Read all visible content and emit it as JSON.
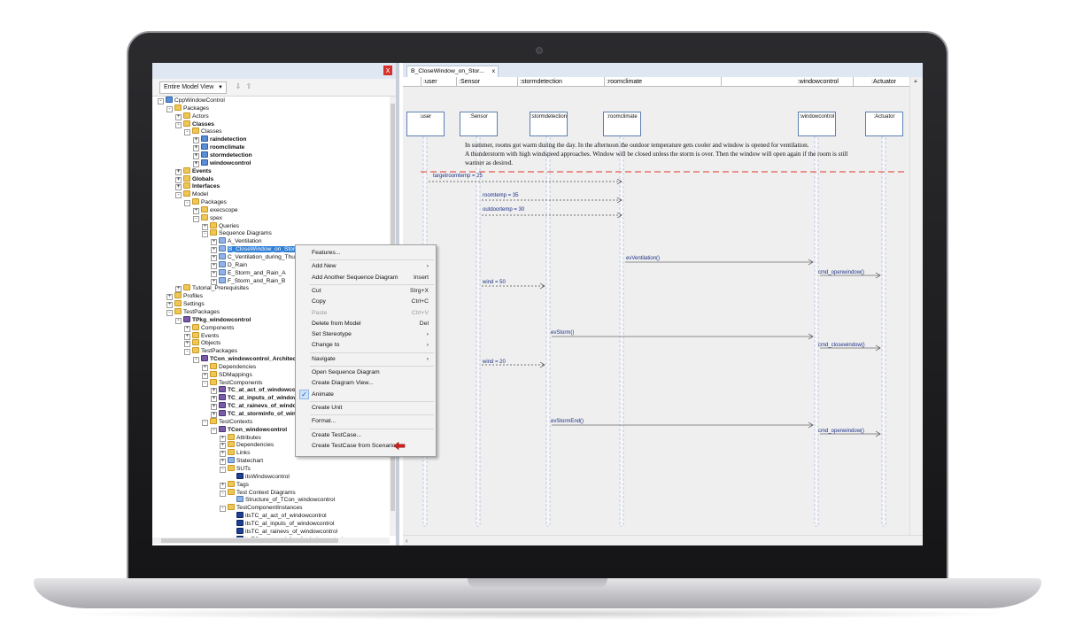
{
  "tree": {
    "view_select": "Entire Model View",
    "close_label": "x",
    "items": [
      {
        "label": "CppWindowControl",
        "depth": 0,
        "icon": "project",
        "exp": "-"
      },
      {
        "label": "Packages",
        "depth": 1,
        "icon": "folder",
        "exp": "-"
      },
      {
        "label": "Actors",
        "depth": 2,
        "icon": "folder",
        "exp": "+"
      },
      {
        "label": "Classes",
        "depth": 2,
        "icon": "folder",
        "exp": "-",
        "bold": true
      },
      {
        "label": "Classes",
        "depth": 3,
        "icon": "folder",
        "exp": "-"
      },
      {
        "label": "raindetection",
        "depth": 4,
        "icon": "class",
        "exp": "+",
        "bold": true
      },
      {
        "label": "roomclimate",
        "depth": 4,
        "icon": "class",
        "exp": "+",
        "bold": true
      },
      {
        "label": "stormdetection",
        "depth": 4,
        "icon": "class",
        "exp": "+",
        "bold": true
      },
      {
        "label": "windowcontrol",
        "depth": 4,
        "icon": "class",
        "exp": "+",
        "bold": true
      },
      {
        "label": "Events",
        "depth": 2,
        "icon": "folder",
        "exp": "+",
        "bold": true
      },
      {
        "label": "Globals",
        "depth": 2,
        "icon": "folder",
        "exp": "+",
        "bold": true
      },
      {
        "label": "Interfaces",
        "depth": 2,
        "icon": "folder",
        "exp": "+",
        "bold": true
      },
      {
        "label": "Model",
        "depth": 2,
        "icon": "folder",
        "exp": "-"
      },
      {
        "label": "Packages",
        "depth": 3,
        "icon": "folder",
        "exp": "-"
      },
      {
        "label": "execscope",
        "depth": 4,
        "icon": "folder",
        "exp": "+"
      },
      {
        "label": "spex",
        "depth": 4,
        "icon": "folder",
        "exp": "-"
      },
      {
        "label": "Queries",
        "depth": 5,
        "icon": "folder",
        "exp": "+"
      },
      {
        "label": "Sequence Diagrams",
        "depth": 5,
        "icon": "folder",
        "exp": "-"
      },
      {
        "label": "A_Ventilation",
        "depth": 6,
        "icon": "diag",
        "exp": "+"
      },
      {
        "label": "B_CloseWindow_on_Storm",
        "depth": 6,
        "icon": "diag",
        "exp": "+",
        "selected": true
      },
      {
        "label": "C_Ventilation_during_Thu",
        "depth": 6,
        "icon": "diag",
        "exp": "+"
      },
      {
        "label": "D_Rain",
        "depth": 6,
        "icon": "diag",
        "exp": "+"
      },
      {
        "label": "E_Storm_and_Rain_A",
        "depth": 6,
        "icon": "diag",
        "exp": "+"
      },
      {
        "label": "F_Storm_and_Rain_B",
        "depth": 6,
        "icon": "diag",
        "exp": "+"
      },
      {
        "label": "Tutorial_Prerequisites",
        "depth": 2,
        "icon": "folder",
        "exp": "+"
      },
      {
        "label": "Profiles",
        "depth": 1,
        "icon": "folder",
        "exp": "+"
      },
      {
        "label": "Settings",
        "depth": 1,
        "icon": "folder",
        "exp": "+"
      },
      {
        "label": "TestPackages",
        "depth": 1,
        "icon": "folder",
        "exp": "-"
      },
      {
        "label": "TPkg_windowcontrol",
        "depth": 2,
        "icon": "tc",
        "exp": "-",
        "bold": true
      },
      {
        "label": "Components",
        "depth": 3,
        "icon": "folder",
        "exp": "+"
      },
      {
        "label": "Events",
        "depth": 3,
        "icon": "folder",
        "exp": "+"
      },
      {
        "label": "Objects",
        "depth": 3,
        "icon": "folder",
        "exp": "+"
      },
      {
        "label": "TestPackages",
        "depth": 3,
        "icon": "folder",
        "exp": "-"
      },
      {
        "label": "TCon_windowcontrol_Architect",
        "depth": 4,
        "icon": "tc",
        "exp": "-",
        "bold": true
      },
      {
        "label": "Dependencies",
        "depth": 5,
        "icon": "folder",
        "exp": "+"
      },
      {
        "label": "SDMappings",
        "depth": 5,
        "icon": "folder",
        "exp": "+"
      },
      {
        "label": "TestComponents",
        "depth": 5,
        "icon": "folder",
        "exp": "-"
      },
      {
        "label": "TC_at_act_of_windowcon",
        "depth": 6,
        "icon": "tc",
        "exp": "+",
        "bold": true
      },
      {
        "label": "TC_at_inputs_of_window",
        "depth": 6,
        "icon": "tc",
        "exp": "+",
        "bold": true
      },
      {
        "label": "TC_at_rainevs_of_windo",
        "depth": 6,
        "icon": "tc",
        "exp": "+",
        "bold": true
      },
      {
        "label": "TC_at_storminfo_of_wind",
        "depth": 6,
        "icon": "tc",
        "exp": "+",
        "bold": true
      },
      {
        "label": "TestContexts",
        "depth": 5,
        "icon": "folder",
        "exp": "-"
      },
      {
        "label": "TCon_windowcontrol",
        "depth": 6,
        "icon": "tc",
        "exp": "-",
        "bold": true
      },
      {
        "label": "Attributes",
        "depth": 7,
        "icon": "folder",
        "exp": "+"
      },
      {
        "label": "Dependencies",
        "depth": 7,
        "icon": "folder",
        "exp": "+"
      },
      {
        "label": "Links",
        "depth": 7,
        "icon": "folder",
        "exp": "+"
      },
      {
        "label": "Statechart",
        "depth": 7,
        "icon": "diag",
        "exp": "+"
      },
      {
        "label": "SUTs",
        "depth": 7,
        "icon": "folder",
        "exp": "-"
      },
      {
        "label": "itsWindowcontrol",
        "depth": 8,
        "icon": "inst",
        "exp": ""
      },
      {
        "label": "Tags",
        "depth": 7,
        "icon": "folder",
        "exp": "+"
      },
      {
        "label": "Test Context Diagrams",
        "depth": 7,
        "icon": "folder",
        "exp": "-"
      },
      {
        "label": "Structure_of_TCon_windowcontrol",
        "depth": 8,
        "icon": "diag",
        "exp": ""
      },
      {
        "label": "TestComponentInstances",
        "depth": 7,
        "icon": "folder",
        "exp": "-"
      },
      {
        "label": "itsTC_at_act_of_windowcontrol",
        "depth": 8,
        "icon": "inst",
        "exp": ""
      },
      {
        "label": "itsTC_at_inputs_of_windowcontrol",
        "depth": 8,
        "icon": "inst",
        "exp": ""
      },
      {
        "label": "itsTC_at_rainevs_of_windowcontrol",
        "depth": 8,
        "icon": "inst",
        "exp": ""
      },
      {
        "label": "itsTC_at_storminfo_of_windowcontrol",
        "depth": 8,
        "icon": "inst",
        "exp": ""
      }
    ]
  },
  "context_menu": {
    "items": [
      {
        "label": "Features...",
        "shortcut": "",
        "submenu": false
      },
      {
        "sep": true
      },
      {
        "label": "Add New",
        "shortcut": "›",
        "submenu": true
      },
      {
        "label": "Add Another Sequence Diagram",
        "shortcut": "Insert",
        "submenu": false
      },
      {
        "sep": true
      },
      {
        "label": "Cut",
        "shortcut": "Strg+X",
        "submenu": false
      },
      {
        "label": "Copy",
        "shortcut": "Ctrl+C",
        "submenu": false
      },
      {
        "label": "Paste",
        "shortcut": "Ctrl+V",
        "submenu": false,
        "disabled": true
      },
      {
        "label": "Delete from Model",
        "shortcut": "Del",
        "submenu": false
      },
      {
        "label": "Set Stereotype",
        "shortcut": "›",
        "submenu": true
      },
      {
        "label": "Change to",
        "shortcut": "›",
        "submenu": true
      },
      {
        "sep": true
      },
      {
        "label": "Navigate",
        "shortcut": "›",
        "submenu": true
      },
      {
        "sep": true
      },
      {
        "label": "Open Sequence Diagram",
        "shortcut": "",
        "submenu": false
      },
      {
        "label": "Create Diagram View...",
        "shortcut": "",
        "submenu": false
      },
      {
        "label": "Animate",
        "shortcut": "",
        "submenu": false,
        "checked": true
      },
      {
        "sep": true
      },
      {
        "label": "Create Unit",
        "shortcut": "",
        "submenu": false
      },
      {
        "sep": true
      },
      {
        "label": "Format...",
        "shortcut": "",
        "submenu": false
      },
      {
        "sep": true
      },
      {
        "label": "Create TestCase...",
        "shortcut": "",
        "submenu": false
      },
      {
        "label": "Create TestCase from Scenario",
        "shortcut": "",
        "submenu": false,
        "highlight_arrow": true
      }
    ]
  },
  "diagram": {
    "tab_title": "B_CloseWindow_on_Stor...",
    "tab_close": "x",
    "header_lanes": [
      ":user",
      ":Sensor",
      ":stormdetection",
      ":roomclimate",
      ":windowcontrol",
      ":Actuator"
    ],
    "lifelines": [
      ":user",
      ":Sensor",
      ":stormdetection",
      ":roomclimate",
      ":windowcontrol",
      ":Actuator"
    ],
    "note_lines": [
      "In summer, rooms got warm during the day. In the afternoon the outdoor temperature gets cooler and window is opened for ventilation.",
      "A thunderstorm with high windspeed approaches. Window will be closed unless the storm is over. Then the window will open again if the room is still",
      "warmer as desired."
    ],
    "messages": [
      "targetroomtemp = 25",
      "roomtemp = 35",
      "outdoortemp = 30",
      "evVentilation()",
      "cmd_openwindow()",
      "wind = 50",
      "evStorm()",
      "cmd_closewindow()",
      "wind = 20",
      "evStormEnd()",
      "cmd_openwindow()"
    ],
    "accent_color": "#1b2f85",
    "separator_color": "#e0342a"
  }
}
